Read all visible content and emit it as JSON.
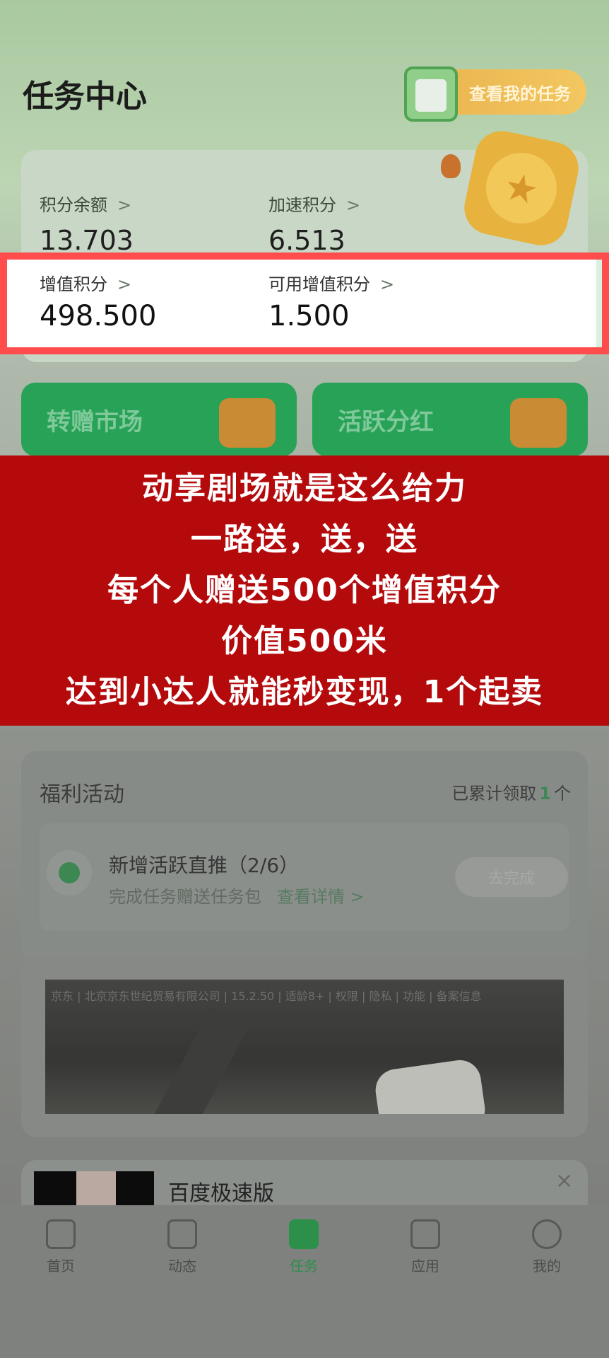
{
  "header": {
    "title": "任务中心",
    "my_tasks_label": "查看我的任务"
  },
  "points": {
    "balance_label": "积分余额",
    "balance_value": "13.703",
    "speed_label": "加速积分",
    "speed_value": "6.513",
    "value_added_label": "增值积分",
    "value_added_value": "498.500",
    "available_label": "可用增值积分",
    "available_value": "1.500"
  },
  "promos": [
    {
      "label": "转赠市场"
    },
    {
      "label": "活跃分红"
    }
  ],
  "banner": {
    "lines": [
      "动享剧场就是这么给力",
      "一路送，送，送",
      "每个人赠送500个增值积分",
      "价值500米",
      "达到小达人就能秒变现，1个起卖"
    ]
  },
  "welfare": {
    "title": "福利活动",
    "count_prefix": "已累计领取",
    "count_value": "1",
    "count_suffix": "个",
    "item": {
      "title": "新增活跃直推（2/6）",
      "subtitle": "完成任务赠送任务包",
      "link": "查看详情 >",
      "button": "去完成"
    }
  },
  "ad": {
    "info": "京东 | 北京京东世纪贸易有限公司 | 15.2.50 | 适龄8+ | 权限 | 隐私 | 功能 | 备案信息"
  },
  "news": {
    "title": "百度极速版",
    "close": "×"
  },
  "tabs": [
    {
      "label": "首页"
    },
    {
      "label": "动态"
    },
    {
      "label": "任务"
    },
    {
      "label": "应用"
    },
    {
      "label": "我的"
    }
  ],
  "colors": {
    "accent": "#2c8f4a",
    "banner_red": "#b50a0c",
    "highlight_border": "#ff4d4d"
  }
}
